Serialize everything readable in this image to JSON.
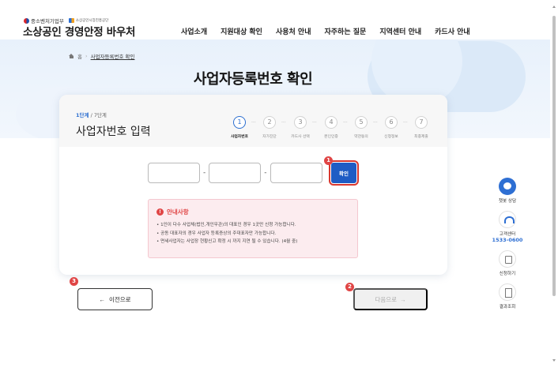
{
  "header": {
    "logo_mss": "중소벤처기업부",
    "logo_semas": "소상공인시장진흥공단",
    "brand": "소상공인 경영안정 바우처",
    "nav": [
      "사업소개",
      "지원대상 확인",
      "사용처 안내",
      "자주하는 질문",
      "지역센터 안내",
      "카드사 안내"
    ]
  },
  "breadcrumb": {
    "home": "홈",
    "current": "사업자등록번호 확인"
  },
  "page_title": "사업자등록번호 확인",
  "card": {
    "step_current": "1단계",
    "step_total": "/ 7단계",
    "title": "사업자번호 입력",
    "steps": [
      {
        "num": "1",
        "label": "사업자번호",
        "active": true
      },
      {
        "num": "2",
        "label": "자가진단"
      },
      {
        "num": "3",
        "label": "카드사 선택"
      },
      {
        "num": "4",
        "label": "본인인증"
      },
      {
        "num": "5",
        "label": "약관동의"
      },
      {
        "num": "6",
        "label": "신청정보"
      },
      {
        "num": "7",
        "label": "최종제출"
      }
    ],
    "separator": "-",
    "confirm_label": "확인",
    "notice": {
      "title": "안내사항",
      "items": [
        "• 1인이 다수 사업체(법인,개인무관)의 대표인 경우 1곳만 신청 가능합니다.",
        "• 공동 대표자의 경우 사업자 등록증상의 주대표자만 가능합니다.",
        "• 면세사업자는 사업장 현황신고 확정 시 까지 지연 될 수 있습니다. (4월 중)"
      ]
    }
  },
  "buttons": {
    "prev": "이전으로",
    "prev_arrow": "←",
    "next": "다음으로",
    "next_arrow": "→"
  },
  "markers": [
    "1",
    "2",
    "3"
  ],
  "quick_menu": {
    "chat": "챗봇 상담",
    "center": "고객센터",
    "phone": "1533-0600",
    "apply": "신청하기",
    "result": "결과조회"
  },
  "colors": {
    "primary": "#1f5cc4",
    "marker": "#e04545",
    "notice_bg": "#fcecef"
  }
}
